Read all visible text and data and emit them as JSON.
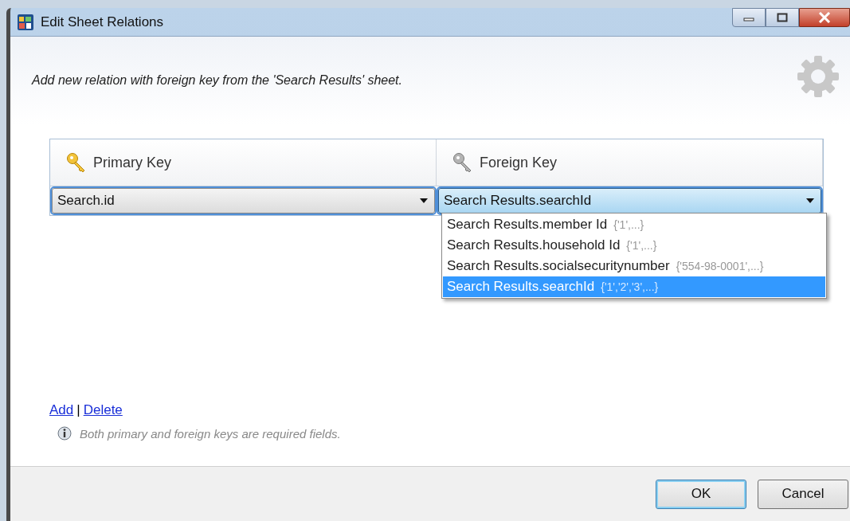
{
  "window": {
    "title": "Edit Sheet Relations"
  },
  "header": {
    "description": "Add new relation with foreign key from the 'Search Results' sheet."
  },
  "grid": {
    "columns": [
      {
        "label": "Primary Key",
        "kind": "primary"
      },
      {
        "label": "Foreign Key",
        "kind": "foreign"
      }
    ],
    "rows": [
      {
        "cells": [
          {
            "value": "Search.id",
            "focused": false
          },
          {
            "value": "Search Results.searchId",
            "focused": true
          }
        ]
      }
    ]
  },
  "dropdown": {
    "options": [
      {
        "label": "Search Results.member Id",
        "sample": "{'1',...}",
        "selected": false
      },
      {
        "label": "Search Results.household Id",
        "sample": "{'1',...}",
        "selected": false
      },
      {
        "label": "Search Results.socialsecuritynumber",
        "sample": "{'554-98-0001',...}",
        "selected": false
      },
      {
        "label": "Search Results.searchId",
        "sample": "{'1','2','3',...}",
        "selected": true
      }
    ]
  },
  "links": {
    "add": "Add",
    "separator": "|",
    "delete": "Delete"
  },
  "hint": "Both primary and foreign keys are required fields.",
  "buttons": [
    {
      "label": "OK",
      "default": true
    },
    {
      "label": "Cancel",
      "default": false
    }
  ]
}
